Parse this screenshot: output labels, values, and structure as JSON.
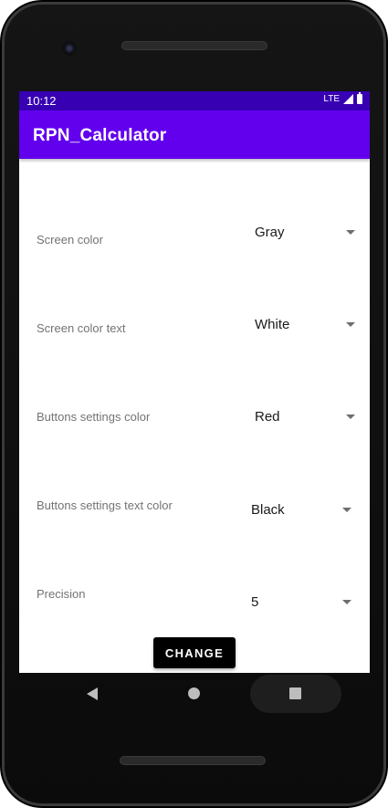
{
  "status_bar": {
    "time": "10:12",
    "network": "LTE"
  },
  "app_bar": {
    "title": "RPN_Calculator"
  },
  "settings": [
    {
      "label": "Screen color",
      "value": "Gray"
    },
    {
      "label": "Screen color text",
      "value": "White"
    },
    {
      "label": "Buttons settings color",
      "value": "Red"
    },
    {
      "label": "Buttons settings text color",
      "value": "Black"
    },
    {
      "label": "Precision",
      "value": "5"
    }
  ],
  "actions": {
    "change_label": "CHANGE"
  },
  "colors": {
    "status_bar": "#3700b3",
    "app_bar": "#6200ee",
    "button": "#000000"
  },
  "icons": [
    "signal-icon",
    "battery-icon",
    "dropdown-arrow-icon",
    "back-icon",
    "home-icon",
    "recents-icon"
  ]
}
